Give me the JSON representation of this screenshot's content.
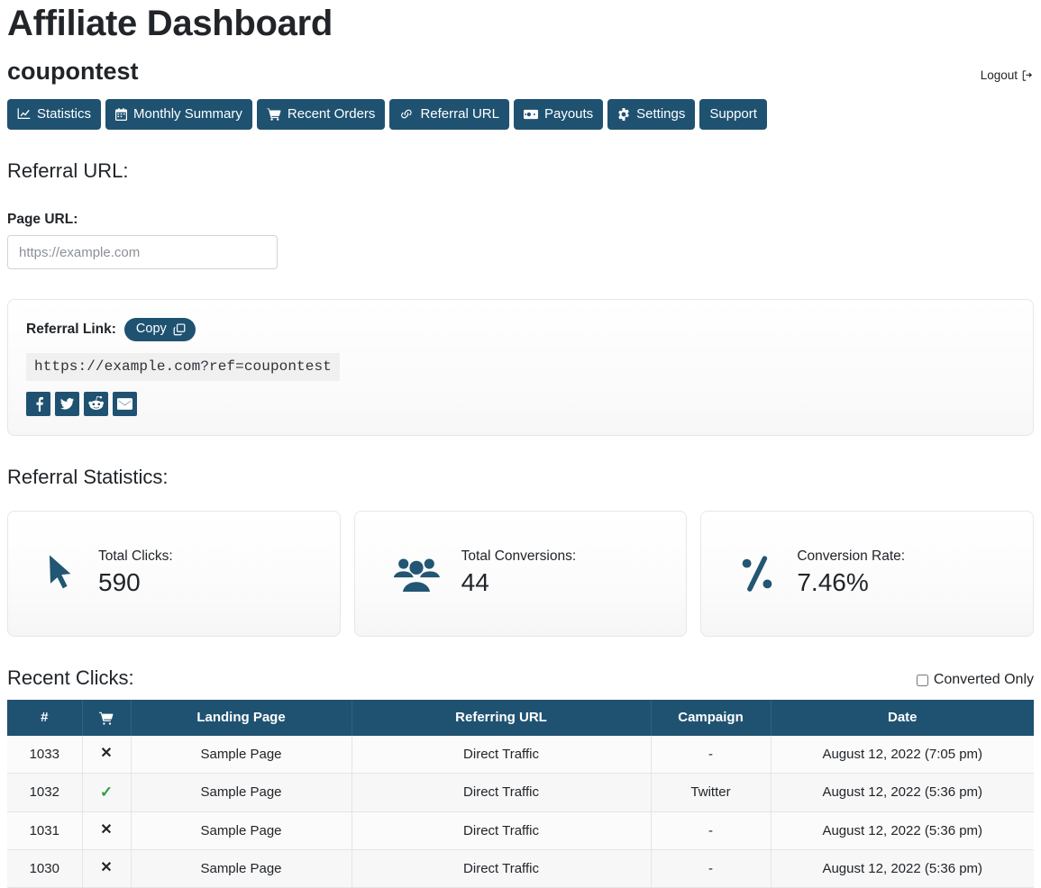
{
  "header": {
    "title": "Affiliate Dashboard",
    "account_name": "coupontest",
    "logout_label": "Logout",
    "logout_icon": "sign-out-icon"
  },
  "nav": {
    "items": [
      {
        "label": "Statistics",
        "icon": "chart-line-icon"
      },
      {
        "label": "Monthly Summary",
        "icon": "calendar-icon"
      },
      {
        "label": "Recent Orders",
        "icon": "shopping-cart-icon"
      },
      {
        "label": "Referral URL",
        "icon": "link-icon"
      },
      {
        "label": "Payouts",
        "icon": "money-bill-icon"
      },
      {
        "label": "Settings",
        "icon": "gear-icon"
      },
      {
        "label": "Support",
        "icon": ""
      }
    ]
  },
  "referral_section": {
    "heading": "Referral URL:",
    "page_url_label": "Page URL:",
    "page_url_value": "",
    "page_url_placeholder": "https://example.com",
    "referral_link_label": "Referral Link:",
    "copy_label": "Copy",
    "copy_icon": "copy-icon",
    "referral_url": "https://example.com?ref=coupontest",
    "social": [
      {
        "name": "facebook-icon",
        "label": "Facebook"
      },
      {
        "name": "twitter-icon",
        "label": "Twitter"
      },
      {
        "name": "reddit-icon",
        "label": "Reddit"
      },
      {
        "name": "email-icon",
        "label": "Email"
      }
    ]
  },
  "statistics_section": {
    "heading": "Referral Statistics:",
    "cards": [
      {
        "icon": "mouse-pointer-icon",
        "label": "Total Clicks:",
        "value": "590"
      },
      {
        "icon": "users-icon",
        "label": "Total Conversions:",
        "value": "44"
      },
      {
        "icon": "percent-icon",
        "label": "Conversion Rate:",
        "value": "7.46%"
      }
    ]
  },
  "recent_clicks": {
    "heading": "Recent Clicks:",
    "converted_only_label": "Converted Only",
    "converted_only_checked": false,
    "columns": [
      {
        "label": "#",
        "icon": ""
      },
      {
        "label": "",
        "icon": "cart-plus-icon"
      },
      {
        "label": "Landing Page",
        "icon": ""
      },
      {
        "label": "Referring URL",
        "icon": ""
      },
      {
        "label": "Campaign",
        "icon": ""
      },
      {
        "label": "Date",
        "icon": ""
      }
    ],
    "rows": [
      {
        "id": "1033",
        "converted": false,
        "converted_mark": "✕",
        "landing_page": "Sample Page",
        "referring_url": "Direct Traffic",
        "campaign": "-",
        "date": "August 12, 2022 (7:05 pm)"
      },
      {
        "id": "1032",
        "converted": true,
        "converted_mark": "✓",
        "landing_page": "Sample Page",
        "referring_url": "Direct Traffic",
        "campaign": "Twitter",
        "date": "August 12, 2022 (5:36 pm)"
      },
      {
        "id": "1031",
        "converted": false,
        "converted_mark": "✕",
        "landing_page": "Sample Page",
        "referring_url": "Direct Traffic",
        "campaign": "-",
        "date": "August 12, 2022 (5:36 pm)"
      },
      {
        "id": "1030",
        "converted": false,
        "converted_mark": "✕",
        "landing_page": "Sample Page",
        "referring_url": "Direct Traffic",
        "campaign": "-",
        "date": "August 12, 2022 (5:36 pm)"
      }
    ]
  },
  "colors": {
    "brand_dark_blue": "#1f5271",
    "check_green": "#2f9e44",
    "card_border": "#e6e7e8",
    "code_bg": "#f0f0f0"
  }
}
